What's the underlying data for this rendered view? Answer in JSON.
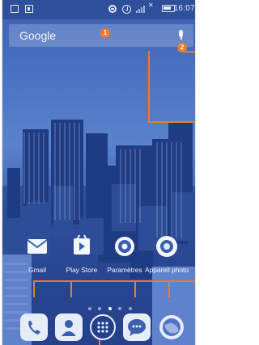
{
  "status_bar": {
    "time": "16:07",
    "icons": [
      "message-icon",
      "image-icon",
      "do-not-disturb-icon",
      "alarm-icon",
      "signal-icon",
      "no-data-icon",
      "battery-icon"
    ]
  },
  "search": {
    "logo": "Google",
    "callout_search": "1",
    "callout_mic": "2"
  },
  "apps": [
    {
      "label": "Gmail",
      "icon": "gmail-icon"
    },
    {
      "label": "Play Store",
      "icon": "play-store-icon"
    },
    {
      "label": "Paramètres",
      "icon": "settings-icon"
    },
    {
      "label": "Appareil photo",
      "icon": "camera-icon"
    }
  ],
  "page_indicator": {
    "count": 5,
    "active_index": 2
  },
  "dock": [
    {
      "icon": "phone-icon"
    },
    {
      "icon": "contacts-icon"
    },
    {
      "icon": "app-drawer-icon"
    },
    {
      "icon": "messaging-icon"
    },
    {
      "icon": "browser-icon"
    }
  ],
  "colors": {
    "annotation": "#f07a28",
    "wallpaper_tint": "#3b5fb0"
  }
}
